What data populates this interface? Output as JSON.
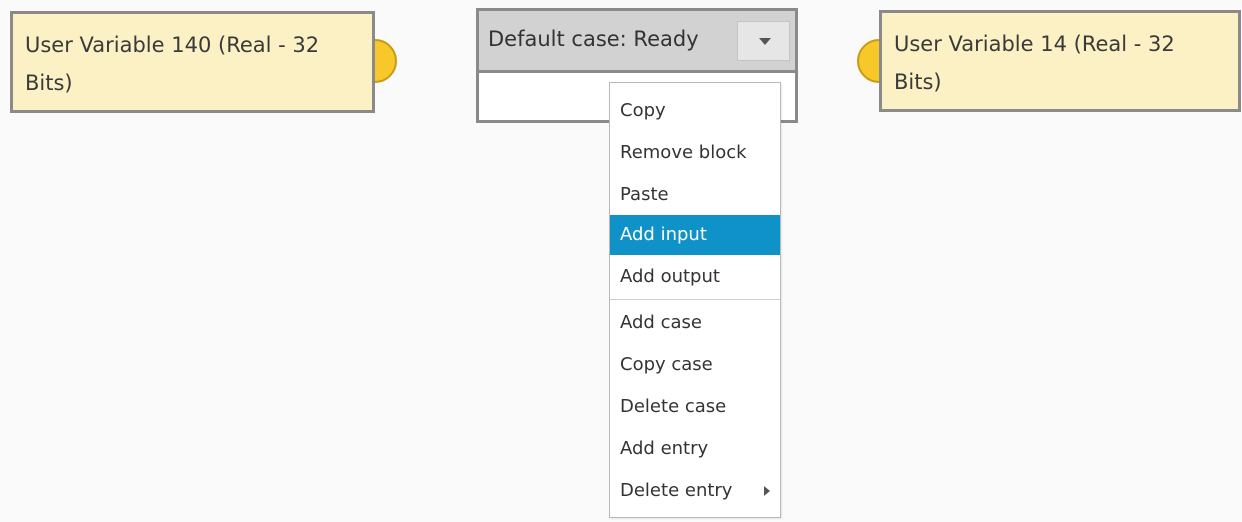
{
  "blocks": {
    "left_variable": {
      "line1": "User Variable 140 (Real - 32",
      "line2": "Bits)"
    },
    "right_variable": {
      "line1": "User Variable 14 (Real - 32",
      "line2": "Bits)"
    },
    "switch": {
      "label": "Default case: Ready",
      "dropdown_icon": "chevron-down-icon"
    }
  },
  "context_menu": {
    "items": [
      {
        "label": "Copy",
        "active": false
      },
      {
        "label": "Remove block",
        "active": false
      },
      {
        "label": "Paste",
        "active": false
      },
      {
        "label": "Add input",
        "active": true
      },
      {
        "label": "Add output",
        "active": false
      },
      {
        "label": "Add case",
        "active": false
      },
      {
        "label": "Copy case",
        "active": false
      },
      {
        "label": "Delete case",
        "active": false
      },
      {
        "label": "Add entry",
        "active": false
      },
      {
        "label": "Delete entry",
        "active": false,
        "submenu_icon": "chevron-right-icon"
      }
    ]
  },
  "colors": {
    "background": "#fafafa",
    "variable_fill": "#fbf1c5",
    "block_border": "#8a8a8a",
    "port_fill": "#f7c82a",
    "switch_header": "#d2d2d2",
    "menu_highlight": "#0f92c8"
  }
}
